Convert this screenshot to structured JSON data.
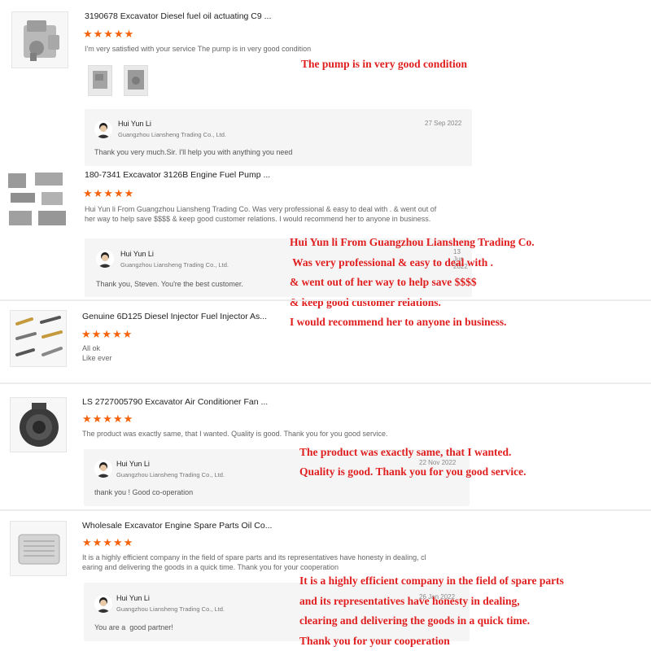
{
  "colors": {
    "star": "#f5620b",
    "annotation": "#e02020",
    "reply_bg": "#f5f5f6"
  },
  "icons": {
    "star": "star-icon",
    "avatar": "user-avatar"
  },
  "reviews": [
    {
      "product_title": "3190678 Excavator Diesel fuel oil actuating C9 ...",
      "stars": "★★★★★",
      "text": [
        "I'm very satisfied with your service The pump is in very good condition"
      ],
      "reply": {
        "name": "Hui Yun Li",
        "company": "Guangzhou Liansheng Trading Co., Ltd.",
        "date": "27 Sep 2022",
        "message": "Thank you very much.Sir. I'll help you with anything you need"
      },
      "annotation": [
        "The pump is in very good condition"
      ]
    },
    {
      "product_title": "180-7341 Excavator 3126B Engine Fuel Pump ...",
      "stars": "★★★★★",
      "text": [
        "Hui Yun li From Guangzhou Liansheng Trading Co. Was very professional & easy to deal with . & went out of",
        "her way to help save $$$$ & keep good customer relations. I would recommend her to anyone in business."
      ],
      "reply": {
        "name": "Hui Yun Li",
        "company": "Guangzhou Liansheng Trading Co., Ltd.",
        "date": "13 Jun 2022",
        "message": "Thank you, Steven. You're the best customer."
      },
      "annotation": [
        "Hui Yun li From Guangzhou Liansheng Trading Co.",
        " Was very professional & easy to deal with .",
        "& went out of her way to help save $$$$",
        "& keep good customer relations.",
        "I would recommend her to anyone in business."
      ]
    },
    {
      "product_title": "Genuine 6D125 Diesel Injector Fuel Injector As...",
      "stars": "★★★★★",
      "text": [
        "All ok",
        "Like ever"
      ]
    },
    {
      "product_title": "LS 2727005790 Excavator Air Conditioner Fan ...",
      "stars": "★★★★★",
      "text": [
        "The product was exactly same, that I wanted. Quality is good. Thank you for you good service."
      ],
      "reply": {
        "name": "Hui Yun Li",
        "company": "Guangzhou Liansheng Trading Co., Ltd.",
        "date": "22 Nov 2022",
        "message": "thank you ! Good co-operation"
      },
      "annotation": [
        "The product was exactly same, that I wanted.",
        "Quality is good. Thank you for you good service."
      ]
    },
    {
      "product_title": "Wholesale Excavator Engine Spare Parts Oil Co...",
      "stars": "★★★★★",
      "text": [
        "It is a highly efficient company in the field of spare parts and its representatives have honesty in dealing, cl",
        "earing and delivering the goods in a quick time. Thank you for your cooperation"
      ],
      "reply": {
        "name": "Hui Yun Li",
        "company": "Guangzhou Liansheng Trading Co., Ltd.",
        "date": "26 Jan 2022",
        "message": "You are a  good partner!"
      },
      "annotation": [
        "It is a highly efficient company in the field of spare parts",
        "and its representatives have honesty in dealing,",
        "clearing and delivering the goods in a quick time.",
        "Thank you for your cooperation"
      ]
    }
  ]
}
